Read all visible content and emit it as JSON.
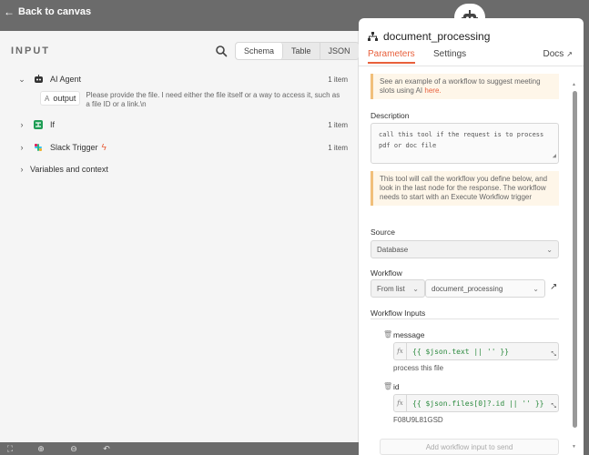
{
  "topbar": {
    "back_label": "Back to canvas"
  },
  "input_panel": {
    "header": "INPUT",
    "view_tabs": [
      "Schema",
      "Table",
      "JSON"
    ],
    "active_view": "Schema",
    "nodes": [
      {
        "name": "AI Agent",
        "count": "1 item",
        "icon": "robot-icon",
        "expanded": true
      },
      {
        "name": "If",
        "count": "1 item",
        "icon": "if-branch-icon",
        "expanded": false
      },
      {
        "name": "Slack Trigger",
        "count": "1 item",
        "icon": "slack-icon",
        "expanded": false,
        "badge": "bolt-icon"
      }
    ],
    "output_field": {
      "type_symbol": "A",
      "name": "output",
      "value": "Please provide the file. I need either the file itself or a way to access it, such as a file ID or a link.\\n"
    },
    "variables_label": "Variables and context"
  },
  "node_panel": {
    "title": "document_processing",
    "tabs": [
      "Parameters",
      "Settings"
    ],
    "active_tab": "Parameters",
    "docs_label": "Docs",
    "notice_ai": {
      "text": "See an example of a workflow to suggest meeting slots using AI",
      "link": "here."
    },
    "description_label": "Description",
    "description_value": "call this tool if the request is to process pdf or doc file",
    "notice_info": "This tool will call the workflow you define below, and look in the last node for the response. The workflow needs to start with an Execute Workflow trigger",
    "source_label": "Source",
    "source_value": "Database",
    "workflow_label": "Workflow",
    "workflow_mode": "From list",
    "workflow_value": "document_processing",
    "inputs_label": "Workflow Inputs",
    "inputs": [
      {
        "name": "message",
        "expression": "{{ $json.text || '' }}",
        "preview": "process this file"
      },
      {
        "name": "id",
        "expression": "{{ $json.files[0]?.id || '' }}",
        "preview": "F08U9L81GSD"
      }
    ],
    "add_input_label": "Add workflow input to send"
  },
  "colors": {
    "accent": "#e8603c",
    "notice_bg": "#fef6e9",
    "notice_border": "#f1bf7a",
    "code_green": "#2b8a3e",
    "overlay": "#6b6b6b"
  }
}
